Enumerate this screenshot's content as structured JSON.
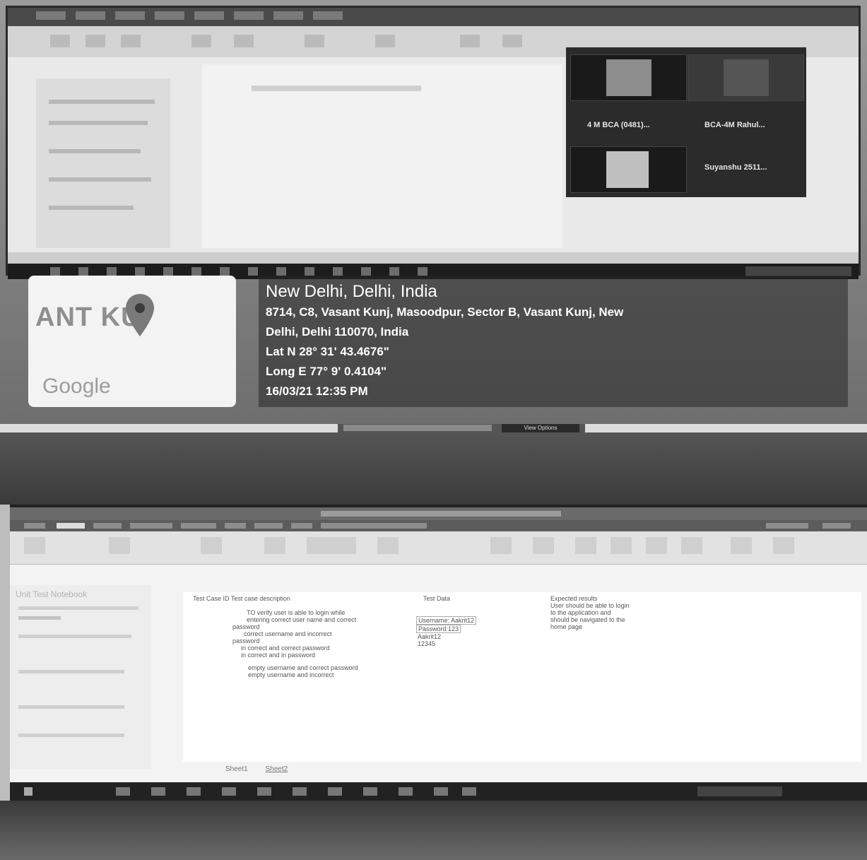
{
  "geotag": {
    "city": "New Delhi, Delhi, India",
    "address_line1": "8714, C8, Vasant Kunj, Masoodpur, Sector B, Vasant Kunj, New",
    "address_line2": "Delhi, Delhi 110070, India",
    "latitude": "Lat N 28° 31' 43.4676\"",
    "longitude": "Long E 77° 9' 0.4104\"",
    "datetime": "16/03/21 12:35 PM",
    "map_place_label": "ANT KU",
    "map_brand": "Google"
  },
  "video_call": {
    "participants": [
      {
        "label": "4 M BCA (0481)..."
      },
      {
        "label": "BCA-4M Rahul..."
      },
      {
        "label": "Suyanshu 2511..."
      }
    ]
  },
  "share_bar": {
    "view_options": "View Options"
  },
  "spreadsheet": {
    "nav_heading": "Unit Test Notebook",
    "header_row": {
      "col_a": "Test Case ID  Test case description",
      "col_b": "Test Data",
      "col_c": "Expected results"
    },
    "rows": [
      "TO verify user is able to login while",
      "entering correct user name and correct",
      "password",
      "correct username and incorrect",
      "password",
      "in correct and correct password",
      "in correct and in password",
      "empty username and correct password",
      "empty username and incorrect"
    ],
    "test_data": [
      "Username: Aakrit12",
      "Password:123",
      "Aakrit12",
      "12345"
    ],
    "expected": [
      "User should be able to login",
      "to the application and",
      "should be navigated to the",
      "home page"
    ],
    "sheet_tabs": [
      "Sheet1",
      "Sheet2"
    ]
  }
}
